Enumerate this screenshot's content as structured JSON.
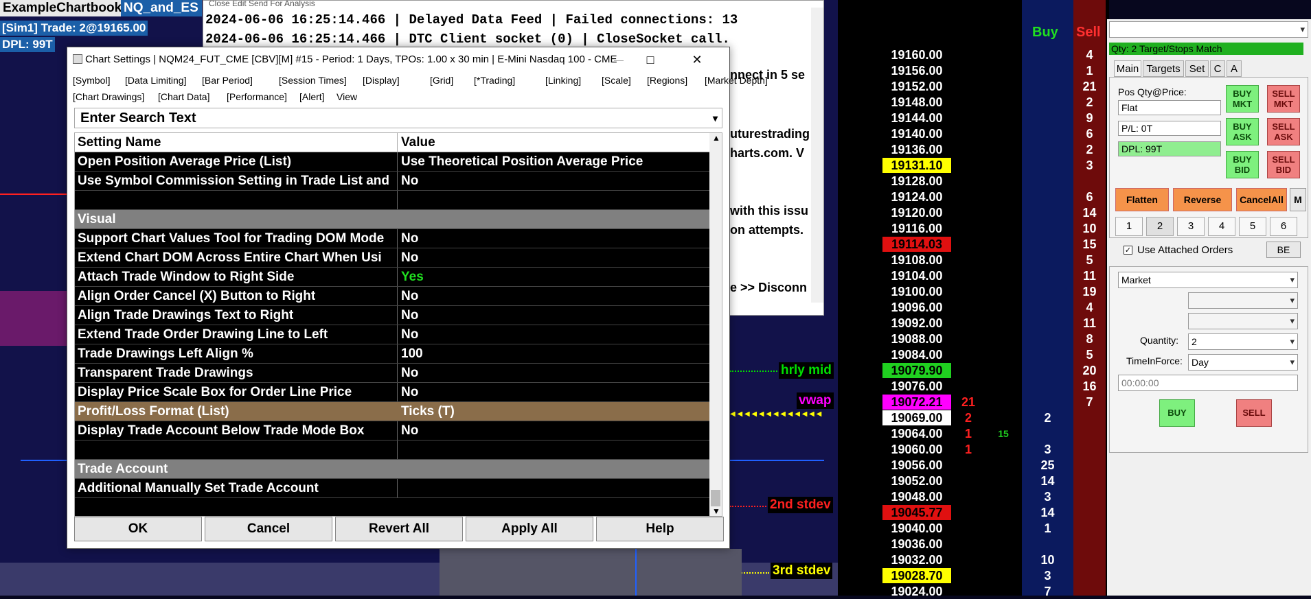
{
  "chart": {
    "tab_book": "ExampleChartbook",
    "tab_chart": "NQ_and_ES",
    "sim_line": "[Sim1]  Trade: 2@19165.00",
    "dpl_line": "DPL: 99T",
    "labels": {
      "hrly_mid": "hrly mid",
      "vwap": "vwap",
      "second_stdev": "2nd stdev",
      "third_stdev": "3rd stdev"
    },
    "colors": {
      "hrly_mid": "#00e000",
      "vwap": "#ff00ff",
      "stdev": "#ff2020",
      "third": "#ffff00"
    }
  },
  "message_log": {
    "menu": "Close   Edit   Send For Analysis",
    "lines": [
      "2024-06-06  16:25:14.466 | Delayed Data Feed | Failed connections: 13",
      "2024-06-06  16:25:14.466 | DTC Client socket (0) | CloseSocket call."
    ],
    "partials": [
      "nnect in 5 se",
      "uturestrading",
      "harts.com.  V",
      "with this issu",
      "on attempts.",
      "e >> Disconn"
    ]
  },
  "dom": {
    "buy_header": "Buy",
    "sell_header": "Sell",
    "rows": [
      {
        "price": "19160.00",
        "sell": "4"
      },
      {
        "price": "19156.00",
        "sell": "1"
      },
      {
        "price": "19152.00",
        "sell": "21"
      },
      {
        "price": "19148.00",
        "sell": "2"
      },
      {
        "price": "19144.00",
        "sell": "9"
      },
      {
        "price": "19140.00",
        "sell": "6"
      },
      {
        "price": "19136.00",
        "sell": "2"
      },
      {
        "price": "19131.10",
        "sell": "3",
        "hl": "#ffff00",
        "hlc": "#000"
      },
      {
        "price": "19128.00",
        "sell": ""
      },
      {
        "price": "19124.00",
        "sell": "6"
      },
      {
        "price": "19120.00",
        "sell": "14"
      },
      {
        "price": "19116.00",
        "sell": "10"
      },
      {
        "price": "19114.03",
        "sell": "15",
        "hl": "#e01010",
        "hlc": "#000"
      },
      {
        "price": "19108.00",
        "sell": "5"
      },
      {
        "price": "19104.00",
        "sell": "11"
      },
      {
        "price": "19100.00",
        "sell": "19"
      },
      {
        "price": "19096.00",
        "sell": "4"
      },
      {
        "price": "19092.00",
        "sell": "11"
      },
      {
        "price": "19088.00",
        "sell": "8"
      },
      {
        "price": "19084.00",
        "sell": "5"
      },
      {
        "price": "19079.90",
        "sell": "20",
        "hl": "#20d020",
        "hlc": "#000"
      },
      {
        "price": "19076.00",
        "sell": "16"
      },
      {
        "price": "19072.21",
        "sell": "7",
        "hl": "#ff00ff",
        "hlc": "#000",
        "vol": "21"
      },
      {
        "price": "19069.00",
        "buy": "2",
        "hl": "#ffffff",
        "hlc": "#000",
        "vol": "2"
      },
      {
        "price": "19064.00",
        "vol": "1",
        "extra": "15"
      },
      {
        "price": "19060.00",
        "buy": "3",
        "vol": "1"
      },
      {
        "price": "19056.00",
        "buy": "25"
      },
      {
        "price": "19052.00",
        "buy": "14"
      },
      {
        "price": "19048.00",
        "buy": "3"
      },
      {
        "price": "19045.77",
        "buy": "14",
        "hl": "#e01010",
        "hlc": "#000"
      },
      {
        "price": "19040.00",
        "buy": "1"
      },
      {
        "price": "19036.00",
        "buy": ""
      },
      {
        "price": "19032.00",
        "buy": "10"
      },
      {
        "price": "19028.70",
        "buy": "3",
        "hl": "#ffff00",
        "hlc": "#000"
      },
      {
        "price": "19024.00",
        "buy": "7"
      }
    ]
  },
  "trade_window": {
    "qty_status": "Qty: 2 Target/Stops Match",
    "tabs": [
      "Main",
      "Targets",
      "Set",
      "C",
      "A"
    ],
    "pos_label": "Pos Qty@Price:",
    "pos_value": "Flat",
    "pl_value": "P/L: 0T",
    "dpl_value": "DPL: 99T",
    "buy_mkt": "BUY MKT",
    "sell_mkt": "SELL MKT",
    "buy_ask": "BUY ASK",
    "sell_ask": "SELL ASK",
    "buy_bid": "BUY BID",
    "sell_bid": "SELL BID",
    "flatten": "Flatten",
    "reverse": "Reverse",
    "cancel_all": "CancelAll",
    "m": "M",
    "qty_buttons": [
      "1",
      "2",
      "3",
      "4",
      "5",
      "6"
    ],
    "use_attached": "Use Attached Orders",
    "be": "BE",
    "order_type": "Market",
    "quantity_label": "Quantity:",
    "quantity_value": "2",
    "tif_label": "TimeInForce:",
    "tif_value": "Day",
    "time_value": "00:00:00",
    "buy": "BUY",
    "sell": "SELL"
  },
  "dialog": {
    "title": "Chart Settings | NQM24_FUT_CME [CBV][M] #15 - Period: 1 Days, TPOs: 1.00 x 30 min   | E-Mini Nasdaq 100 - CME",
    "menu_row1": [
      "[Symbol]",
      "[Data Limiting]",
      "[Bar Period]",
      "[Session Times]",
      "[Display]",
      "[Grid]",
      "[*Trading]",
      "[Linking]",
      "[Scale]",
      "[Regions]",
      "[Market Depth]"
    ],
    "menu_row2": [
      "[Chart Drawings]",
      "[Chart Data]",
      "[Performance]",
      "[Alert]",
      "View"
    ],
    "search_placeholder": "Enter Search Text",
    "col_name": "Setting Name",
    "col_value": "Value",
    "rows": [
      {
        "name": "Open Position Average Price (List)",
        "value": "Use Theoretical Position Average Price"
      },
      {
        "name": "Use Symbol Commission Setting in Trade List and",
        "value": "No"
      },
      {
        "name": "",
        "value": ""
      },
      {
        "name": "Visual",
        "value": "",
        "section": true
      },
      {
        "name": "Support Chart Values Tool for Trading DOM Mode",
        "value": "No"
      },
      {
        "name": "Extend Chart DOM Across Entire Chart When Usi",
        "value": "No"
      },
      {
        "name": "Attach Trade Window to Right Side",
        "value": "Yes",
        "valcolor": "#20e020"
      },
      {
        "name": "Align Order Cancel (X) Button to Right",
        "value": "No"
      },
      {
        "name": "Align Trade Drawings Text to Right",
        "value": "No"
      },
      {
        "name": "Extend Trade Order Drawing Line to Left",
        "value": "No"
      },
      {
        "name": "Trade Drawings Left Align %",
        "value": "100"
      },
      {
        "name": "Transparent Trade Drawings",
        "value": "No"
      },
      {
        "name": "Display Price Scale Box for Order Line Price",
        "value": "No"
      },
      {
        "name": "Profit/Loss Format (List)",
        "value": "Ticks (T)",
        "selected": true
      },
      {
        "name": "Display Trade Account Below Trade Mode Box",
        "value": "No"
      },
      {
        "name": "",
        "value": ""
      },
      {
        "name": "Trade Account",
        "value": "",
        "section": true
      },
      {
        "name": "Additional Manually Set Trade Account",
        "value": ""
      }
    ],
    "buttons": [
      "OK",
      "Cancel",
      "Revert All",
      "Apply All",
      "Help"
    ]
  }
}
